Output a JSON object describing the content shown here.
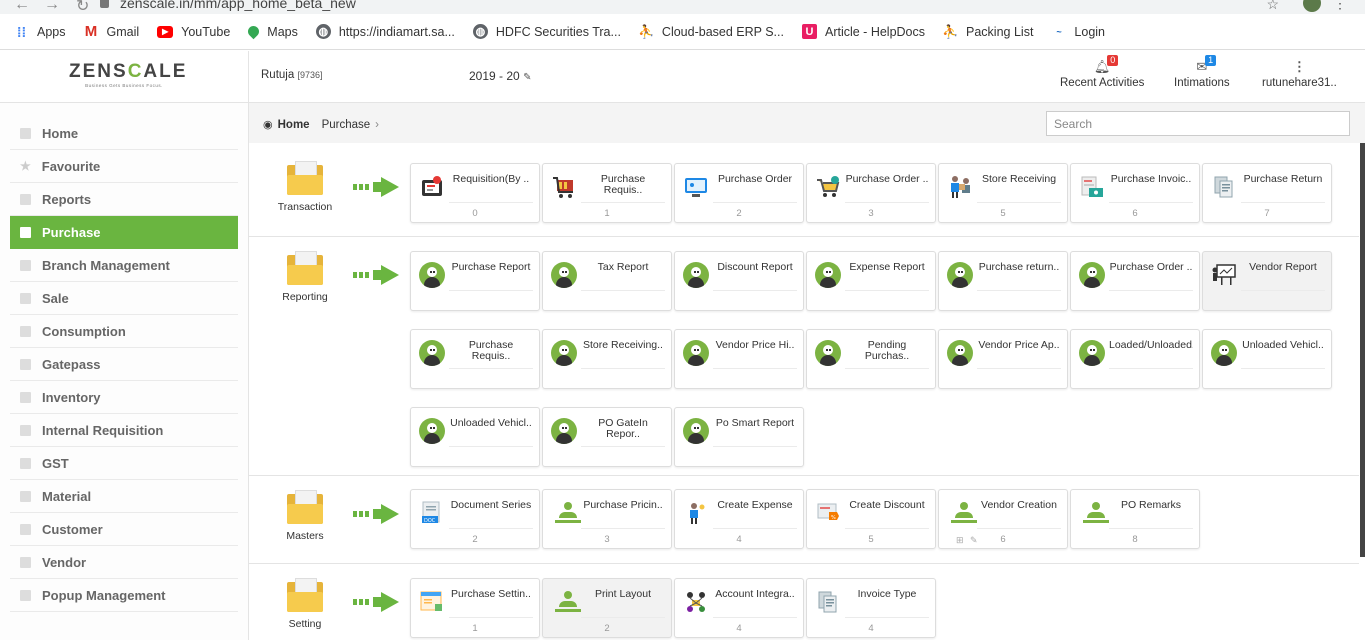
{
  "browser": {
    "url": "zenscale.in/mm/app_home_beta_new",
    "bookmarks": [
      {
        "label": "Apps",
        "icon": "apps-grid-icon",
        "color": "#4285f4"
      },
      {
        "label": "Gmail",
        "icon": "gmail-icon",
        "color": "#d93025"
      },
      {
        "label": "YouTube",
        "icon": "youtube-icon",
        "color": "#ff0000"
      },
      {
        "label": "Maps",
        "icon": "maps-pin-icon",
        "color": "#34a853"
      },
      {
        "label": "https://indiamart.sa...",
        "icon": "globe-icon",
        "color": "#5f6368"
      },
      {
        "label": "HDFC Securities Tra...",
        "icon": "globe-icon",
        "color": "#5f6368"
      },
      {
        "label": "Cloud-based ERP S...",
        "icon": "person-icon",
        "color": "#444444"
      },
      {
        "label": "Article - HelpDocs",
        "icon": "helpdocs-icon",
        "color": "#e91e63"
      },
      {
        "label": "Packing List",
        "icon": "person-icon",
        "color": "#444444"
      },
      {
        "label": "Login",
        "icon": "login-logo-icon",
        "color": "#1565c0"
      }
    ]
  },
  "header": {
    "logo_left": "ZENS",
    "logo_c": "C",
    "logo_right": "ALE",
    "tagline": "Business Gets Business Focus.",
    "user": "Rutuja",
    "user_code": "[9736]",
    "year": "2019 - 20",
    "recent_activities": {
      "label": "Recent Activities",
      "count": "0",
      "badge_color": "#e53935"
    },
    "intimations": {
      "label": "Intimations",
      "count": "1",
      "badge_color": "#1e88e5"
    },
    "account": "rutunehare31.."
  },
  "sidebar": {
    "accent": "#6ab540",
    "items": [
      {
        "label": "Home"
      },
      {
        "label": "Favourite"
      },
      {
        "label": "Reports"
      },
      {
        "label": "Purchase"
      },
      {
        "label": "Branch Management"
      },
      {
        "label": "Sale"
      },
      {
        "label": "Consumption"
      },
      {
        "label": "Gatepass"
      },
      {
        "label": "Inventory"
      },
      {
        "label": "Internal Requisition"
      },
      {
        "label": "GST"
      },
      {
        "label": "Material"
      },
      {
        "label": "Customer"
      },
      {
        "label": "Vendor"
      },
      {
        "label": "Popup Management"
      }
    ],
    "active": "Purchase"
  },
  "breadcrumb": {
    "home": "Home",
    "current": "Purchase"
  },
  "search": {
    "placeholder": "Search"
  },
  "sections": {
    "transaction": {
      "label": "Transaction",
      "tiles": [
        {
          "name": "Requisition(By ..",
          "num": "0",
          "icon": "requisition-icon"
        },
        {
          "name": "Purchase Requis..",
          "num": "1",
          "icon": "cart-icon"
        },
        {
          "name": "Purchase Order",
          "num": "2",
          "icon": "monitor-icon"
        },
        {
          "name": "Purchase Order ..",
          "num": "3",
          "icon": "cart-check-icon"
        },
        {
          "name": "Store Receiving",
          "num": "5",
          "icon": "delivery-person-icon"
        },
        {
          "name": "Purchase Invoic..",
          "num": "6",
          "icon": "invoice-icon"
        },
        {
          "name": "Purchase Return",
          "num": "7",
          "icon": "document-return-icon"
        }
      ]
    },
    "reporting": {
      "label": "Reporting",
      "tiles": [
        {
          "name": "Purchase Report"
        },
        {
          "name": "Tax Report"
        },
        {
          "name": "Discount Report"
        },
        {
          "name": "Expense Report"
        },
        {
          "name": "Purchase return.."
        },
        {
          "name": "Purchase Order .."
        },
        {
          "name": "Vendor Report"
        },
        {
          "name": "Purchase Requis.."
        },
        {
          "name": "Store Receiving.."
        },
        {
          "name": "Vendor Price Hi.."
        },
        {
          "name": "Pending Purchas.."
        },
        {
          "name": "Vendor Price Ap.."
        },
        {
          "name": "Loaded/Unloaded.."
        },
        {
          "name": "Unloaded Vehicl.."
        },
        {
          "name": "Unloaded Vehicl.."
        },
        {
          "name": "PO GateIn Repor.."
        },
        {
          "name": "Po Smart Report"
        }
      ]
    },
    "masters": {
      "label": "Masters",
      "tiles": [
        {
          "name": "Document Series",
          "num": "2",
          "icon": "doc-series-icon"
        },
        {
          "name": "Purchase Pricin..",
          "num": "3",
          "icon": "person-desk-icon"
        },
        {
          "name": "Create Expense",
          "num": "4",
          "icon": "expense-person-icon"
        },
        {
          "name": "Create Discount",
          "num": "5",
          "icon": "discount-icon"
        },
        {
          "name": "Vendor Creation",
          "num": "6",
          "icon": "person-desk-icon"
        },
        {
          "name": "PO Remarks",
          "num": "8",
          "icon": "person-desk-icon"
        }
      ]
    },
    "setting": {
      "label": "Setting",
      "tiles": [
        {
          "name": "Purchase Settin..",
          "num": "1",
          "icon": "settings-doc-icon"
        },
        {
          "name": "Print Layout",
          "num": "2",
          "icon": "person-desk-icon"
        },
        {
          "name": "Account Integra..",
          "num": "4",
          "icon": "integration-icon"
        },
        {
          "name": "Invoice Type",
          "num": "4",
          "icon": "document-icon"
        }
      ]
    }
  }
}
